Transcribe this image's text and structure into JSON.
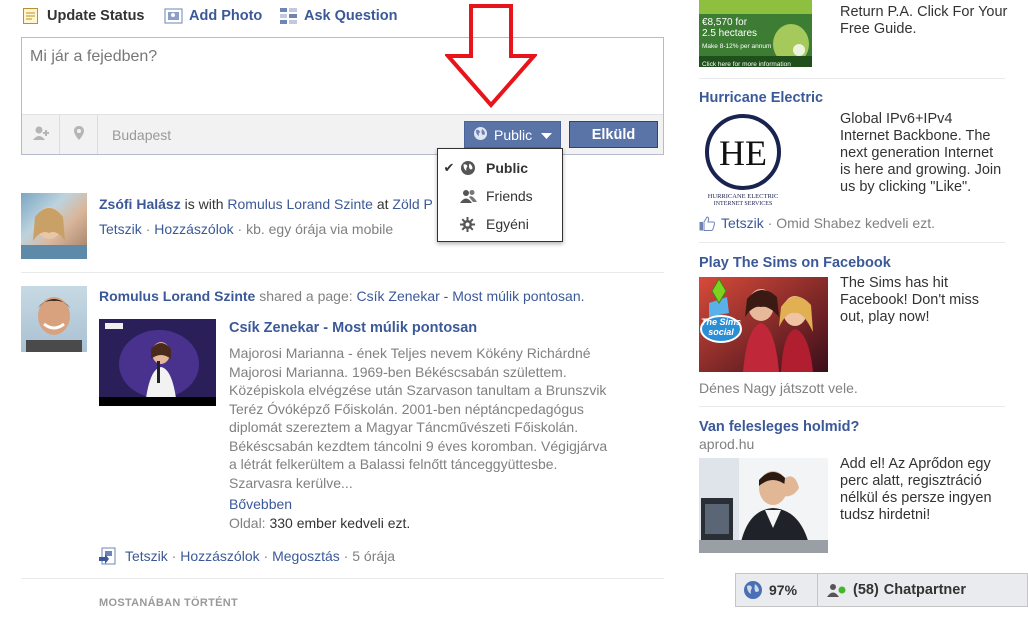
{
  "composer": {
    "tabs": [
      {
        "label": "Update Status"
      },
      {
        "label": "Add Photo"
      },
      {
        "label": "Ask Question"
      }
    ],
    "placeholder": "Mi jár a fejedben?",
    "location": "Budapest",
    "privacy_label": "Public",
    "send_label": "Elküld"
  },
  "privacy_menu": {
    "items": [
      {
        "label": "Public",
        "selected": true,
        "icon": "globe-icon"
      },
      {
        "label": "Friends",
        "selected": false,
        "icon": "friends-icon"
      },
      {
        "label": "Egyéni",
        "selected": false,
        "icon": "gear-icon"
      }
    ]
  },
  "feed": {
    "post1": {
      "author": "Zsófi Halász",
      "with_text": "is with",
      "with_name": "Romulus Lorand Szinte",
      "at_text": "at",
      "place": "Zöld P",
      "like": "Tetszik",
      "comment": "Hozzászólok",
      "time": "kb. egy órája via mobile"
    },
    "post2": {
      "author": "Romulus Lorand Szinte",
      "action": "shared a page:",
      "page": "Csík Zenekar - Most múlik pontosan.",
      "card_title": "Csík Zenekar - Most múlik pontosan",
      "card_lines": [
        "Majorosi Marianna - ének Teljes nevem Kökény Richárdné",
        "Majorosi Marianna. 1969-ben Békéscsabán születtem.",
        "Középiskola elvégzése után Szarvason tanultam a Brunszvik",
        "Teréz Óvóképző Főiskolán. 2001-ben néptáncpedagógus",
        "diplomát szereztem a Magyar Táncművészeti Főiskolán.",
        "Békéscsabán kezdtem táncolni 9 éves koromban. Végigjárva",
        "a létrát felkerültem a Balassi felnőtt tánceggyüttesbe.",
        "Szarvasra kerülve..."
      ],
      "more": "Bővebben",
      "page_label": "Oldal:",
      "page_likes": "330 ember kedveli ezt.",
      "like": "Tetszik",
      "comment": "Hozzászólok",
      "share": "Megosztás",
      "time": "5 órája"
    },
    "section_header": "MOSTANÁBAN TÖRTÉNT"
  },
  "ads": {
    "ad0": {
      "lines": [
        "Return P.A. Click For Your",
        "Free Guide."
      ],
      "img_text": [
        "€8,570 for",
        "2.5 hectares",
        "Make 8-12% per annum",
        "Click here for more information"
      ]
    },
    "ad1": {
      "title": "Hurricane Electric",
      "logo_text": "HE",
      "logo_caption": "HURRICANE ELECTRIC",
      "logo_sub": "INTERNET SERVICES",
      "lines": [
        "Global IPv6+IPv4",
        "Internet Backbone. The",
        "next generation Internet",
        "is here and growing. Join",
        "us by clicking \"Like\"."
      ],
      "like": "Tetszik",
      "social": "Omid Shabez kedveli ezt."
    },
    "ad2": {
      "title": "Play The Sims on Facebook",
      "logo": "The Sims social",
      "lines": [
        "The Sims has hit",
        "Facebook! Don't miss",
        "out, play now!"
      ],
      "social": "Dénes Nagy játszott vele."
    },
    "ad3": {
      "title": "Van felesleges holmid?",
      "domain": "aprod.hu",
      "lines": [
        "Add el! Az Aprődon egy",
        "perc alatt, regisztráció",
        "nélkül és persze ingyen",
        "tudsz hirdetni!"
      ]
    }
  },
  "chat": {
    "percent": "97%",
    "count": "(58)",
    "label": "Chatpartner"
  },
  "colors": {
    "brand": "#3b5998",
    "button": "#5b74a8",
    "arrow": "#e8141b"
  }
}
